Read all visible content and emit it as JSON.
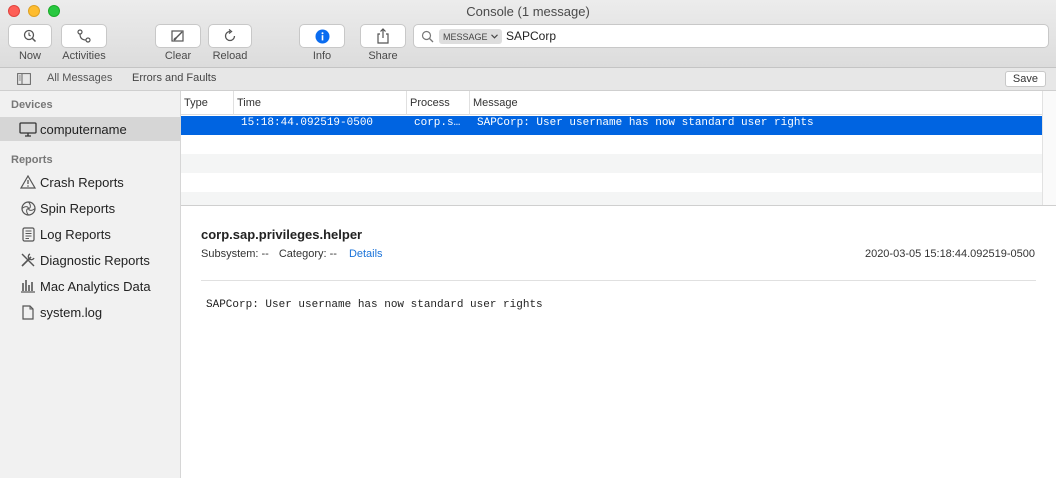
{
  "window": {
    "title": "Console (1 message)"
  },
  "toolbar": {
    "now": "Now",
    "activities": "Activities",
    "clear": "Clear",
    "reload": "Reload",
    "info": "Info",
    "share": "Share"
  },
  "search": {
    "token": "MESSAGE",
    "query": "SAPCorp"
  },
  "filterbar": {
    "all_messages": "All Messages",
    "errors_faults": "Errors and Faults",
    "save": "Save"
  },
  "sidebar": {
    "devices_header": "Devices",
    "device": "computername",
    "reports_header": "Reports",
    "items": [
      {
        "label": "Crash Reports",
        "icon": "warning-icon"
      },
      {
        "label": "Spin Reports",
        "icon": "spin-icon"
      },
      {
        "label": "Log Reports",
        "icon": "log-icon"
      },
      {
        "label": "Diagnostic Reports",
        "icon": "tools-icon"
      },
      {
        "label": "Mac Analytics Data",
        "icon": "bar-chart-icon"
      },
      {
        "label": "system.log",
        "icon": "document-icon"
      }
    ]
  },
  "table": {
    "columns": [
      "Type",
      "Time",
      "Process",
      "Message"
    ],
    "rows": [
      {
        "type": "",
        "time": "15:18:44.092519-0500",
        "process": "corp.s…",
        "message": "SAPCorp: User username has now standard user rights"
      }
    ]
  },
  "detail": {
    "process": "corp.sap.privileges.helper",
    "subsystem": "Subsystem: --",
    "category": "Category: --",
    "details_link": "Details",
    "timestamp": "2020-03-05 15:18:44.092519-0500",
    "message": "SAPCorp: User username has now standard user rights"
  },
  "colors": {
    "selection": "#0064e1",
    "link": "#1a73d9",
    "info_icon": "#0a6cf0"
  }
}
